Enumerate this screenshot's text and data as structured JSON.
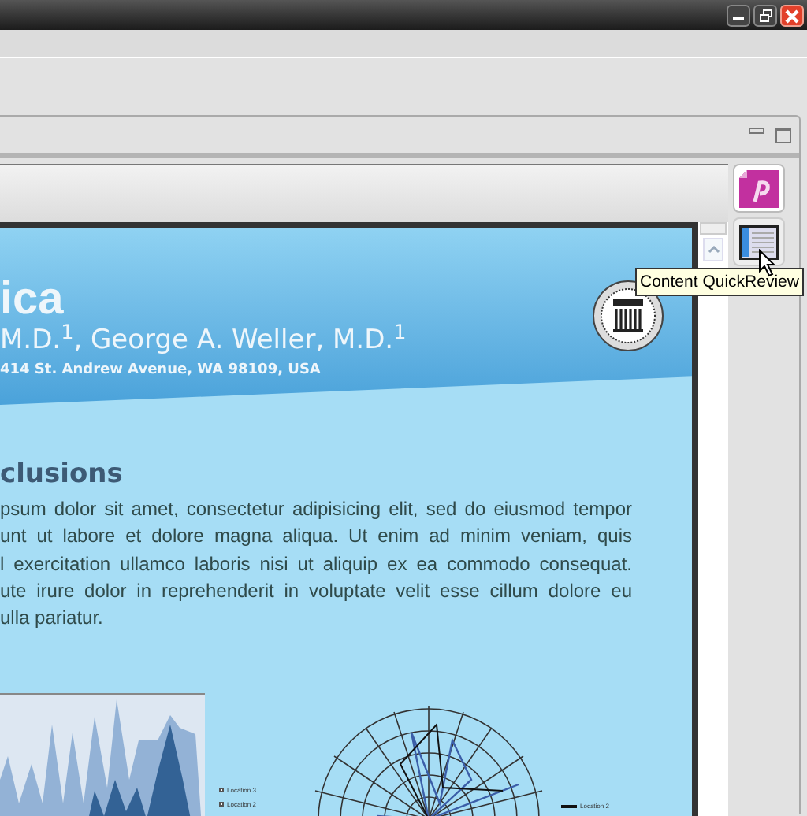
{
  "poster": {
    "title": "ica",
    "authors": "M.D.$^{1}$, George A. Weller, M.D.$^{1}$",
    "address": "414 St. Andrew Avenue, WA 98109, USA",
    "section_heading": "clusions",
    "paragraph_lines": [
      "psum dolor sit amet, consectetur adipisicing elit, sed do eiusmod tempor",
      "unt ut labore et dolore magna aliqua. Ut enim ad minim veniam, quis",
      "l exercitation ullamco laboris nisi ut aliquip ex ea commodo consequat.",
      "ute irure dolor in reprehenderit in voluptate velit esse cillum dolore eu",
      "ulla pariatur."
    ],
    "area_chart_legend": [
      "Location 3",
      "Location 2"
    ],
    "radar_chart_legend": [
      "Location 2"
    ]
  },
  "tooltip": "Content QuickReview"
}
